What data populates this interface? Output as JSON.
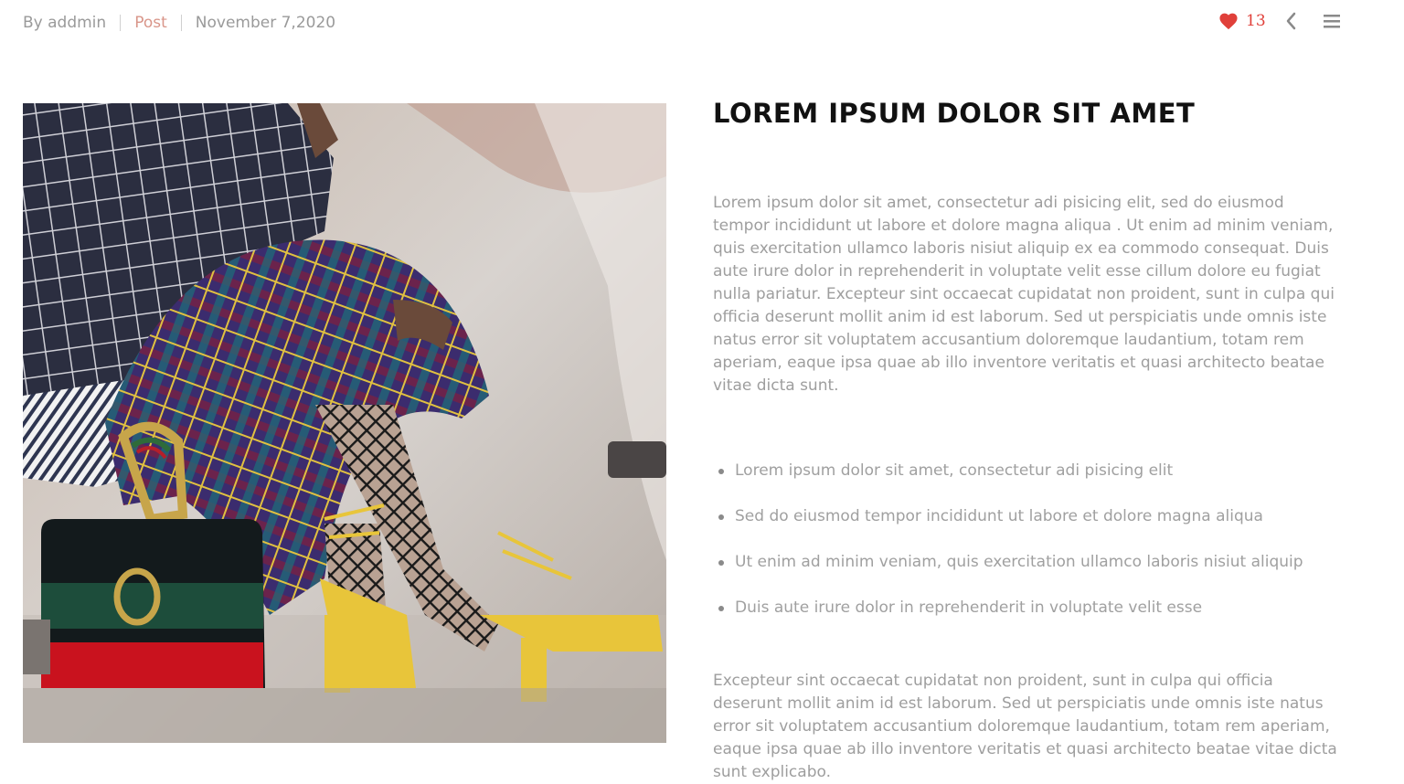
{
  "meta": {
    "author": "By addmin",
    "category": "Post",
    "date": "November 7,2020"
  },
  "actions": {
    "likes_count": "13",
    "like_icon": "heart-icon",
    "prev_icon": "chevron-left-icon",
    "menu_icon": "hamburger-menu-icon",
    "like_color": "#e0403a"
  },
  "article": {
    "title": "LOREM IPSUM DOLOR SIT AMET",
    "paragraph1": "Lorem ipsum dolor sit amet, consectetur adi pisicing elit, sed do eiusmod tempor incididunt ut labore et dolore magna aliqua . Ut enim ad minim veniam, quis exercitation ullamco laboris nisiut aliquip ex ea commodo consequat. Duis aute irure dolor in reprehenderit in voluptate velit esse cillum dolore eu fugiat nulla pariatur. Excepteur sint occaecat cupidatat non proident, sunt in culpa qui officia deserunt mollit anim id est laborum. Sed ut perspiciatis unde omnis iste natus error sit voluptatem accusantium doloremque laudantium, totam rem aperiam, eaque ipsa quae ab illo inventore veritatis et quasi architecto beatae vitae dicta sunt.",
    "bullets": [
      "Lorem ipsum dolor sit amet, consectetur adi pisicing elit",
      "Sed do eiusmod tempor incididunt ut labore et dolore magna aliqua",
      "Ut enim ad minim veniam, quis exercitation ullamco laboris nisiut aliquip",
      "Duis aute irure dolor in reprehenderit in voluptate velit esse"
    ],
    "paragraph2": "Excepteur sint occaecat cupidatat non proident, sunt in culpa qui officia deserunt mollit anim id est laborum. Sed ut perspiciatis unde omnis iste natus error sit voluptatem accusantium doloremque laudantium, totam rem aperiam, eaque ipsa quae ab illo inventore veritatis et quasi architecto beatae vitae dicta sunt explicabo."
  }
}
